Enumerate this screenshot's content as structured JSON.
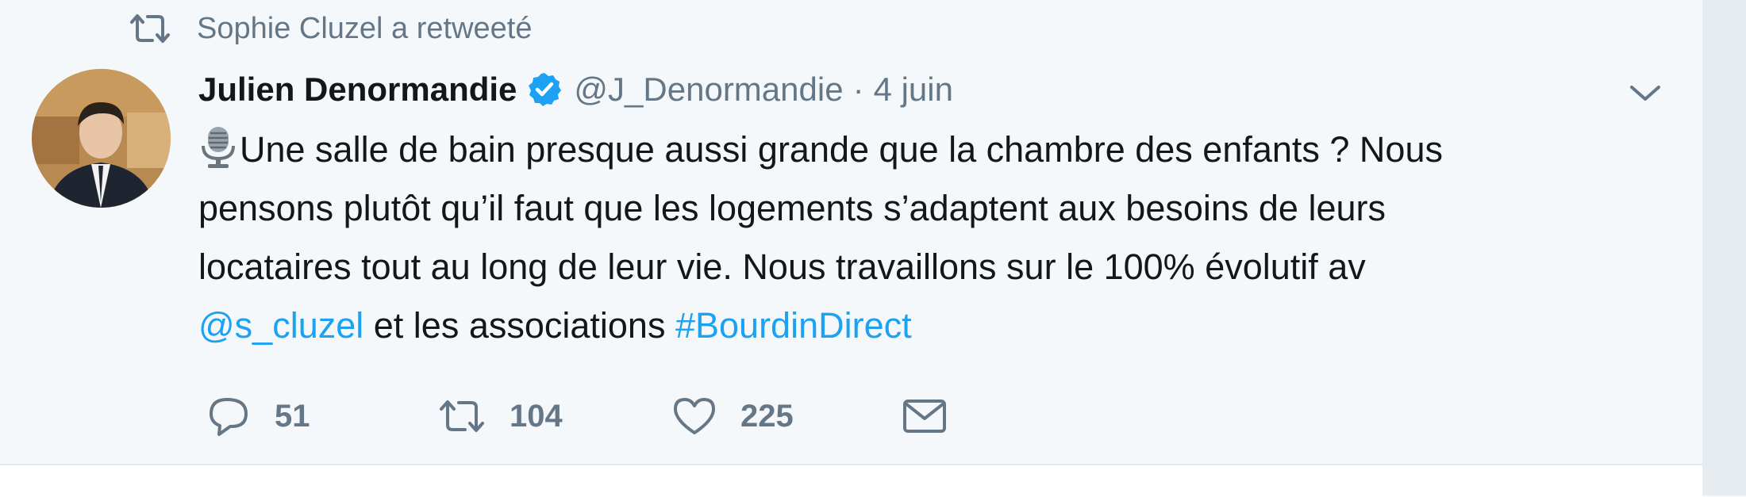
{
  "retweet_context": {
    "text": "Sophie Cluzel a retweeté"
  },
  "tweet": {
    "author": {
      "name": "Julien Denormandie",
      "handle": "@J_Denormandie",
      "verified": true
    },
    "separator": "·",
    "date": "4 juin",
    "body": {
      "line1": "Une salle de bain presque aussi grande que la chambre des enfants ? Nous",
      "line2": "pensons plutôt qu’il faut que les logements s’adaptent aux besoins de leurs",
      "line3": "locataires tout au long de leur vie. Nous travaillons sur le 100% évolutif av",
      "mention": "@s_cluzel",
      "line4_mid": " et les associations ",
      "hashtag": "#BourdinDirect"
    },
    "actions": {
      "replies": "51",
      "retweets": "104",
      "likes": "225"
    }
  },
  "icons": {
    "retweet_context": "retweet-icon",
    "verified": "verified-badge-icon",
    "menu": "chevron-down-icon",
    "emoji": "microphone-emoji-icon",
    "reply": "reply-icon",
    "retweet": "retweet-icon",
    "like": "heart-icon",
    "dm": "envelope-icon"
  },
  "colors": {
    "background": "#f5f8fa",
    "link": "#1da1f2",
    "muted": "#657786",
    "text": "#14171a",
    "verified": "#1da1f2"
  }
}
